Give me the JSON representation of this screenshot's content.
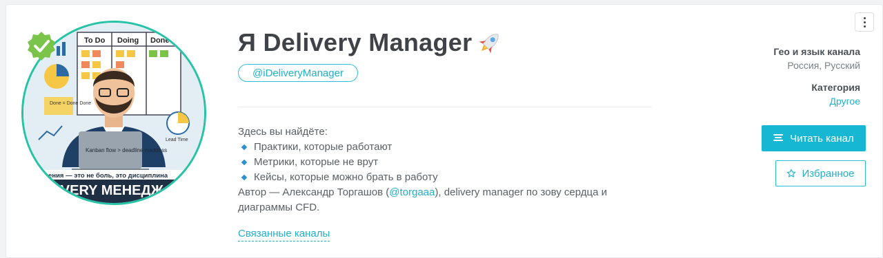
{
  "channel": {
    "title": "Я Delivery Manager",
    "handle": "@iDeliveryManager",
    "description": {
      "intro": "Здесь вы найдёте:",
      "items": [
        "Практики, которые работают",
        "Метрики, которые не врут",
        "Кейсы, которые можно брать в работу"
      ],
      "author_prefix": "Автор — Александр Торгашов (",
      "author_link": "@torgaaa",
      "author_suffix": "), delivery manager по зову сердца и диаграммы CFD."
    },
    "related_link": "Связанные каналы"
  },
  "avatar": {
    "board_columns": [
      "To Do",
      "Doing",
      "Done"
    ],
    "sticky_note": "Done = Done Done",
    "laptop_text": "Kanban flow > deadline maddess",
    "lead_time_label": "Lead Time",
    "banner_line": "менения — это не боль, это дисциплина",
    "banner_bottom": "LIVERY МЕНЕДЖ"
  },
  "sidebar": {
    "geo_heading": "Гео и язык канала",
    "geo_value": "Россия, Русский",
    "category_heading": "Категория",
    "category_value": "Другое",
    "read_button": "Читать канал",
    "favorite_button": "Избранное"
  },
  "icons": {
    "verified": "verified-badge-icon",
    "rocket": "rocket-icon",
    "menu": "more-vertical-icon",
    "read": "list-icon",
    "favorite": "star-icon"
  },
  "colors": {
    "accent": "#16b7d2",
    "verified": "#7bc44a",
    "avatar_border": "#27c3a6"
  }
}
